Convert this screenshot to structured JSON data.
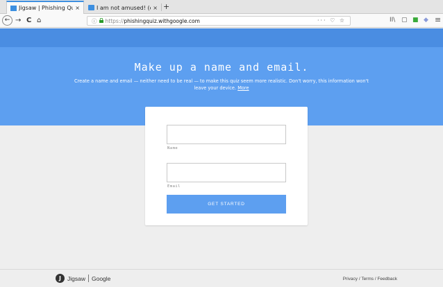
{
  "browser": {
    "tabs": [
      {
        "label": "Jigsaw | Phishing Quiz",
        "close": "×"
      },
      {
        "label": "I am not amused! (or how",
        "close": "×"
      }
    ],
    "new_tab": "+",
    "nav": {
      "back": "←",
      "forward": "→",
      "reload": "C",
      "home": "⌂"
    },
    "url": {
      "info": "ⓘ",
      "lock": "🔒",
      "proto": "https://",
      "host": "phishingquiz.withgoogle.com",
      "actions": "··· ♡ ☆"
    },
    "toolbar_icons": [
      "library-icon",
      "sidebar-icon",
      "extension-icon",
      "extension-icon",
      "menu-icon"
    ],
    "toolbar_glyphs": {
      "library": "II\\",
      "sidebar": "▢",
      "ext1": "■",
      "ext2": "◆",
      "menu": "≡"
    }
  },
  "hero": {
    "title": "Make up a name and email.",
    "description": "Create a name and email — neither need to be real — to make this quiz seem more realistic. Don't worry, this information won't leave your device.",
    "more_link": "More"
  },
  "form": {
    "name_label": "Name",
    "email_label": "Email",
    "start_button": "GET STARTED"
  },
  "footer": {
    "logo_mark": "J",
    "brand": "Jigsaw",
    "google": "Google",
    "privacy": "Privacy",
    "terms": "Terms",
    "feedback": "Feedback",
    "sep": "/"
  },
  "colors": {
    "hero": "#5d9ff0",
    "top_band": "#4a8de2",
    "button": "#5d9ff0"
  }
}
